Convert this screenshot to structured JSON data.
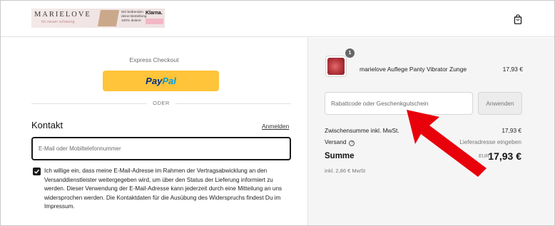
{
  "header": {
    "logo": {
      "brand": "MARIELOVE",
      "tagline": "für neuen schwung.",
      "promo_text": "Wir beibenden deine Bestellung 100% diskret",
      "klarna": "Klarna.",
      "klarna_badge": "..."
    },
    "cart_icon": "shopping-bag-icon"
  },
  "express": {
    "label": "Express Checkout",
    "paypal_pay": "Pay",
    "paypal_pal": "Pal",
    "divider": "ODER"
  },
  "contact": {
    "title": "Kontakt",
    "login_link": "Anmelden",
    "email_placeholder": "E-Mail oder Mobiltelefonnummer",
    "consent_checked": true,
    "consent_text": "Ich willige ein, dass meine E-Mail-Adresse im Rahmen der Vertragsabwicklung an den Versanddienstleister weitergegeben wird, um über den Status der Lieferung informiert zu werden. Dieser Verwendung der E-Mail-Adresse kann jederzeit durch eine Mitteilung an uns widersprochen werden. Die Kontaktdaten für die Ausübung des Widerspruchs findest Du im Impressum."
  },
  "order": {
    "item": {
      "quantity": "1",
      "name": "marielove Auflege Panty Vibrator Zunge",
      "price": "17,93 €"
    },
    "discount_placeholder": "Rabattcode oder Geschenkgutschein",
    "apply_label": "Anwenden",
    "subtotal_label": "Zwischensumme inkl. MwSt.",
    "subtotal_value": "17,93 €",
    "shipping_label": "Versand",
    "shipping_value": "Lieferadresse eingeben",
    "total_label": "Summe",
    "total_currency": "EUR",
    "total_value": "17,93 €",
    "tax_note": "inkl. 2,86 € MwSt"
  },
  "colors": {
    "paypal_yellow": "#ffc439",
    "paypal_dark": "#003087",
    "paypal_light": "#009cde",
    "annotation_arrow": "#e8000b",
    "summary_bg": "#f5f5f5"
  }
}
